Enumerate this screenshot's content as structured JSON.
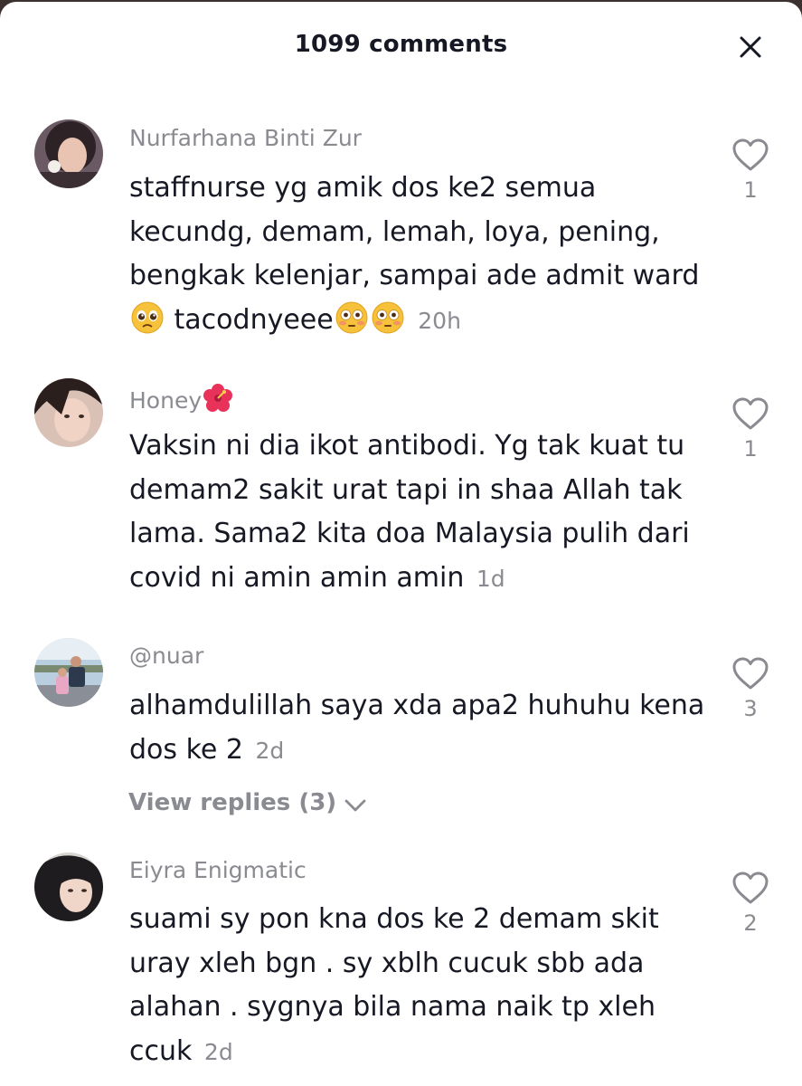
{
  "header": {
    "title": "1099 comments",
    "close_icon": "close-icon"
  },
  "comments": [
    {
      "username": "Nurfarhana Binti Zur",
      "text_parts": [
        "staffnurse yg amik dos ke2 semua kecundg, demam, lemah, loya, pening, bengkak kelenjar, sampai ade admit ward",
        " tacodnyeee"
      ],
      "emojis": [
        "pleading-face-emoji",
        "flushed-face-emoji",
        "flushed-face-emoji"
      ],
      "time": "20h",
      "likes": "1"
    },
    {
      "username": "Honey",
      "username_emoji": "hibiscus-emoji",
      "text": "Vaksin ni dia ikot antibodi. Yg tak kuat tu demam2 sakit urat tapi in shaa Allah tak lama. Sama2 kita doa Malaysia pulih dari covid ni amin amin amin",
      "time": "1d",
      "likes": "1"
    },
    {
      "username": "@nuar",
      "text": "alhamdulillah saya xda apa2 huhuhu kena dos ke 2",
      "time": "2d",
      "likes": "3",
      "view_replies": "View replies (3)"
    },
    {
      "username": "Eiyra Enigmatic",
      "text": "suami sy pon kna dos ke 2 demam skit uray xleh bgn . sy xblh cucuk sbb ada alahan . sygnya bila nama naik tp xleh ccuk",
      "time": "2d",
      "likes": "2"
    }
  ],
  "colors": {
    "primary_text": "#161823",
    "secondary_text": "#8a8b91",
    "background": "#ffffff"
  }
}
